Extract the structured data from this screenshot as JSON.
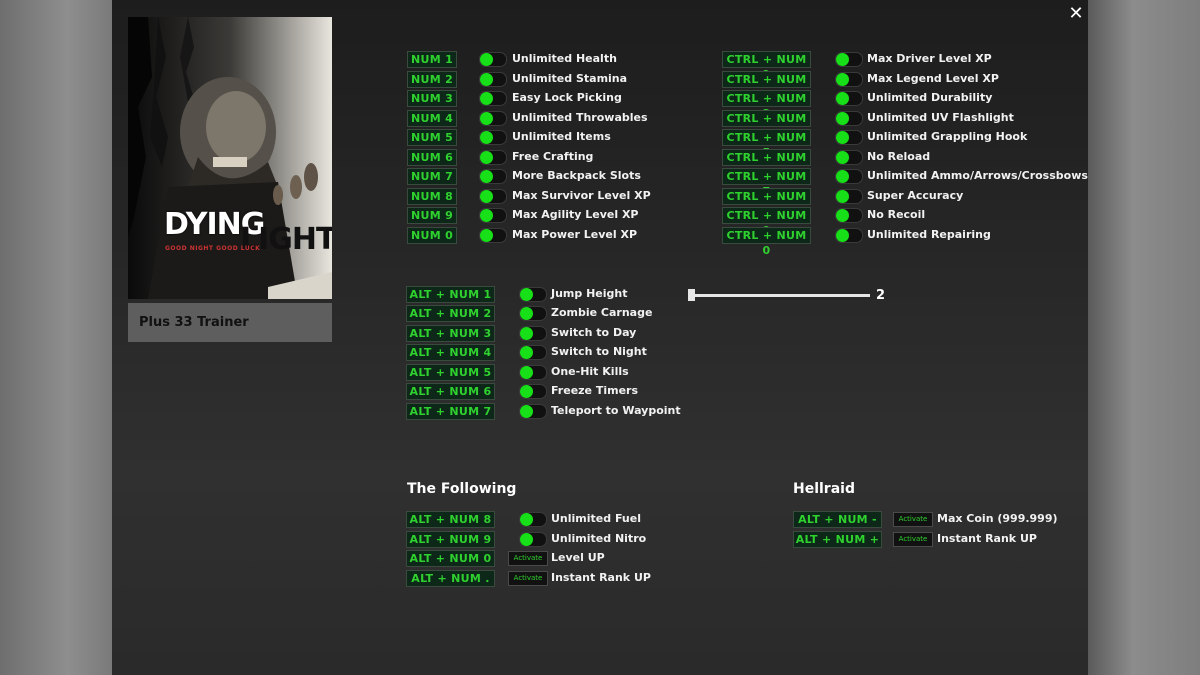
{
  "window": {
    "close_label": "✕"
  },
  "game": {
    "logo_line1": "DYING",
    "logo_line2": "LIGHT",
    "tagline": "GOOD NIGHT GOOD LUCK",
    "trainer_title": "Plus 33 Trainer"
  },
  "cheats_left": [
    {
      "key": "NUM 1",
      "label": "Unlimited Health"
    },
    {
      "key": "NUM 2",
      "label": "Unlimited Stamina"
    },
    {
      "key": "NUM 3",
      "label": "Easy Lock Picking"
    },
    {
      "key": "NUM 4",
      "label": "Unlimited Throwables"
    },
    {
      "key": "NUM 5",
      "label": "Unlimited Items"
    },
    {
      "key": "NUM 6",
      "label": "Free Crafting"
    },
    {
      "key": "NUM 7",
      "label": "More Backpack Slots"
    },
    {
      "key": "NUM 8",
      "label": "Max Survivor Level XP"
    },
    {
      "key": "NUM 9",
      "label": "Max Agility Level XP"
    },
    {
      "key": "NUM 0",
      "label": "Max Power Level XP"
    }
  ],
  "cheats_right": [
    {
      "key": "CTRL + NUM 1",
      "label": "Max Driver Level XP"
    },
    {
      "key": "CTRL + NUM 2",
      "label": "Max Legend Level XP"
    },
    {
      "key": "CTRL + NUM 3",
      "label": "Unlimited Durability"
    },
    {
      "key": "CTRL + NUM 4",
      "label": "Unlimited UV Flashlight"
    },
    {
      "key": "CTRL + NUM 5",
      "label": "Unlimited Grappling Hook"
    },
    {
      "key": "CTRL + NUM 6",
      "label": "No Reload"
    },
    {
      "key": "CTRL + NUM 7",
      "label": "Unlimited Ammo/Arrows/Crossbows"
    },
    {
      "key": "CTRL + NUM 8",
      "label": "Super Accuracy"
    },
    {
      "key": "CTRL + NUM 9",
      "label": "No Recoil"
    },
    {
      "key": "CTRL + NUM 0",
      "label": "Unlimited Repairing"
    }
  ],
  "cheats_alt": [
    {
      "key": "ALT + NUM 1",
      "label": "Jump Height"
    },
    {
      "key": "ALT + NUM 2",
      "label": "Zombie Carnage"
    },
    {
      "key": "ALT + NUM 3",
      "label": "Switch to Day"
    },
    {
      "key": "ALT + NUM 4",
      "label": "Switch to Night"
    },
    {
      "key": "ALT + NUM 5",
      "label": "One-Hit Kills"
    },
    {
      "key": "ALT + NUM 6",
      "label": "Freeze Timers"
    },
    {
      "key": "ALT + NUM 7",
      "label": "Teleport to Waypoint"
    }
  ],
  "jump_slider": {
    "value": "2"
  },
  "following": {
    "title": "The Following",
    "items": [
      {
        "key": "ALT + NUM 8",
        "label": "Unlimited Fuel",
        "control": "toggle"
      },
      {
        "key": "ALT + NUM 9",
        "label": "Unlimited Nitro",
        "control": "toggle"
      },
      {
        "key": "ALT + NUM 0",
        "label": "Level UP",
        "control": "Activate"
      },
      {
        "key": "ALT + NUM .",
        "label": "Instant Rank UP",
        "control": "Activate"
      }
    ]
  },
  "hellraid": {
    "title": "Hellraid",
    "items": [
      {
        "key": "ALT + NUM -",
        "label": "Max Coin (999.999)",
        "control": "Activate"
      },
      {
        "key": "ALT + NUM +",
        "label": "Instant Rank UP",
        "control": "Activate"
      }
    ]
  },
  "colors": {
    "key_text": "#2fd12f",
    "toggle_on": "#18e018",
    "key_bg": "#0d2818"
  }
}
